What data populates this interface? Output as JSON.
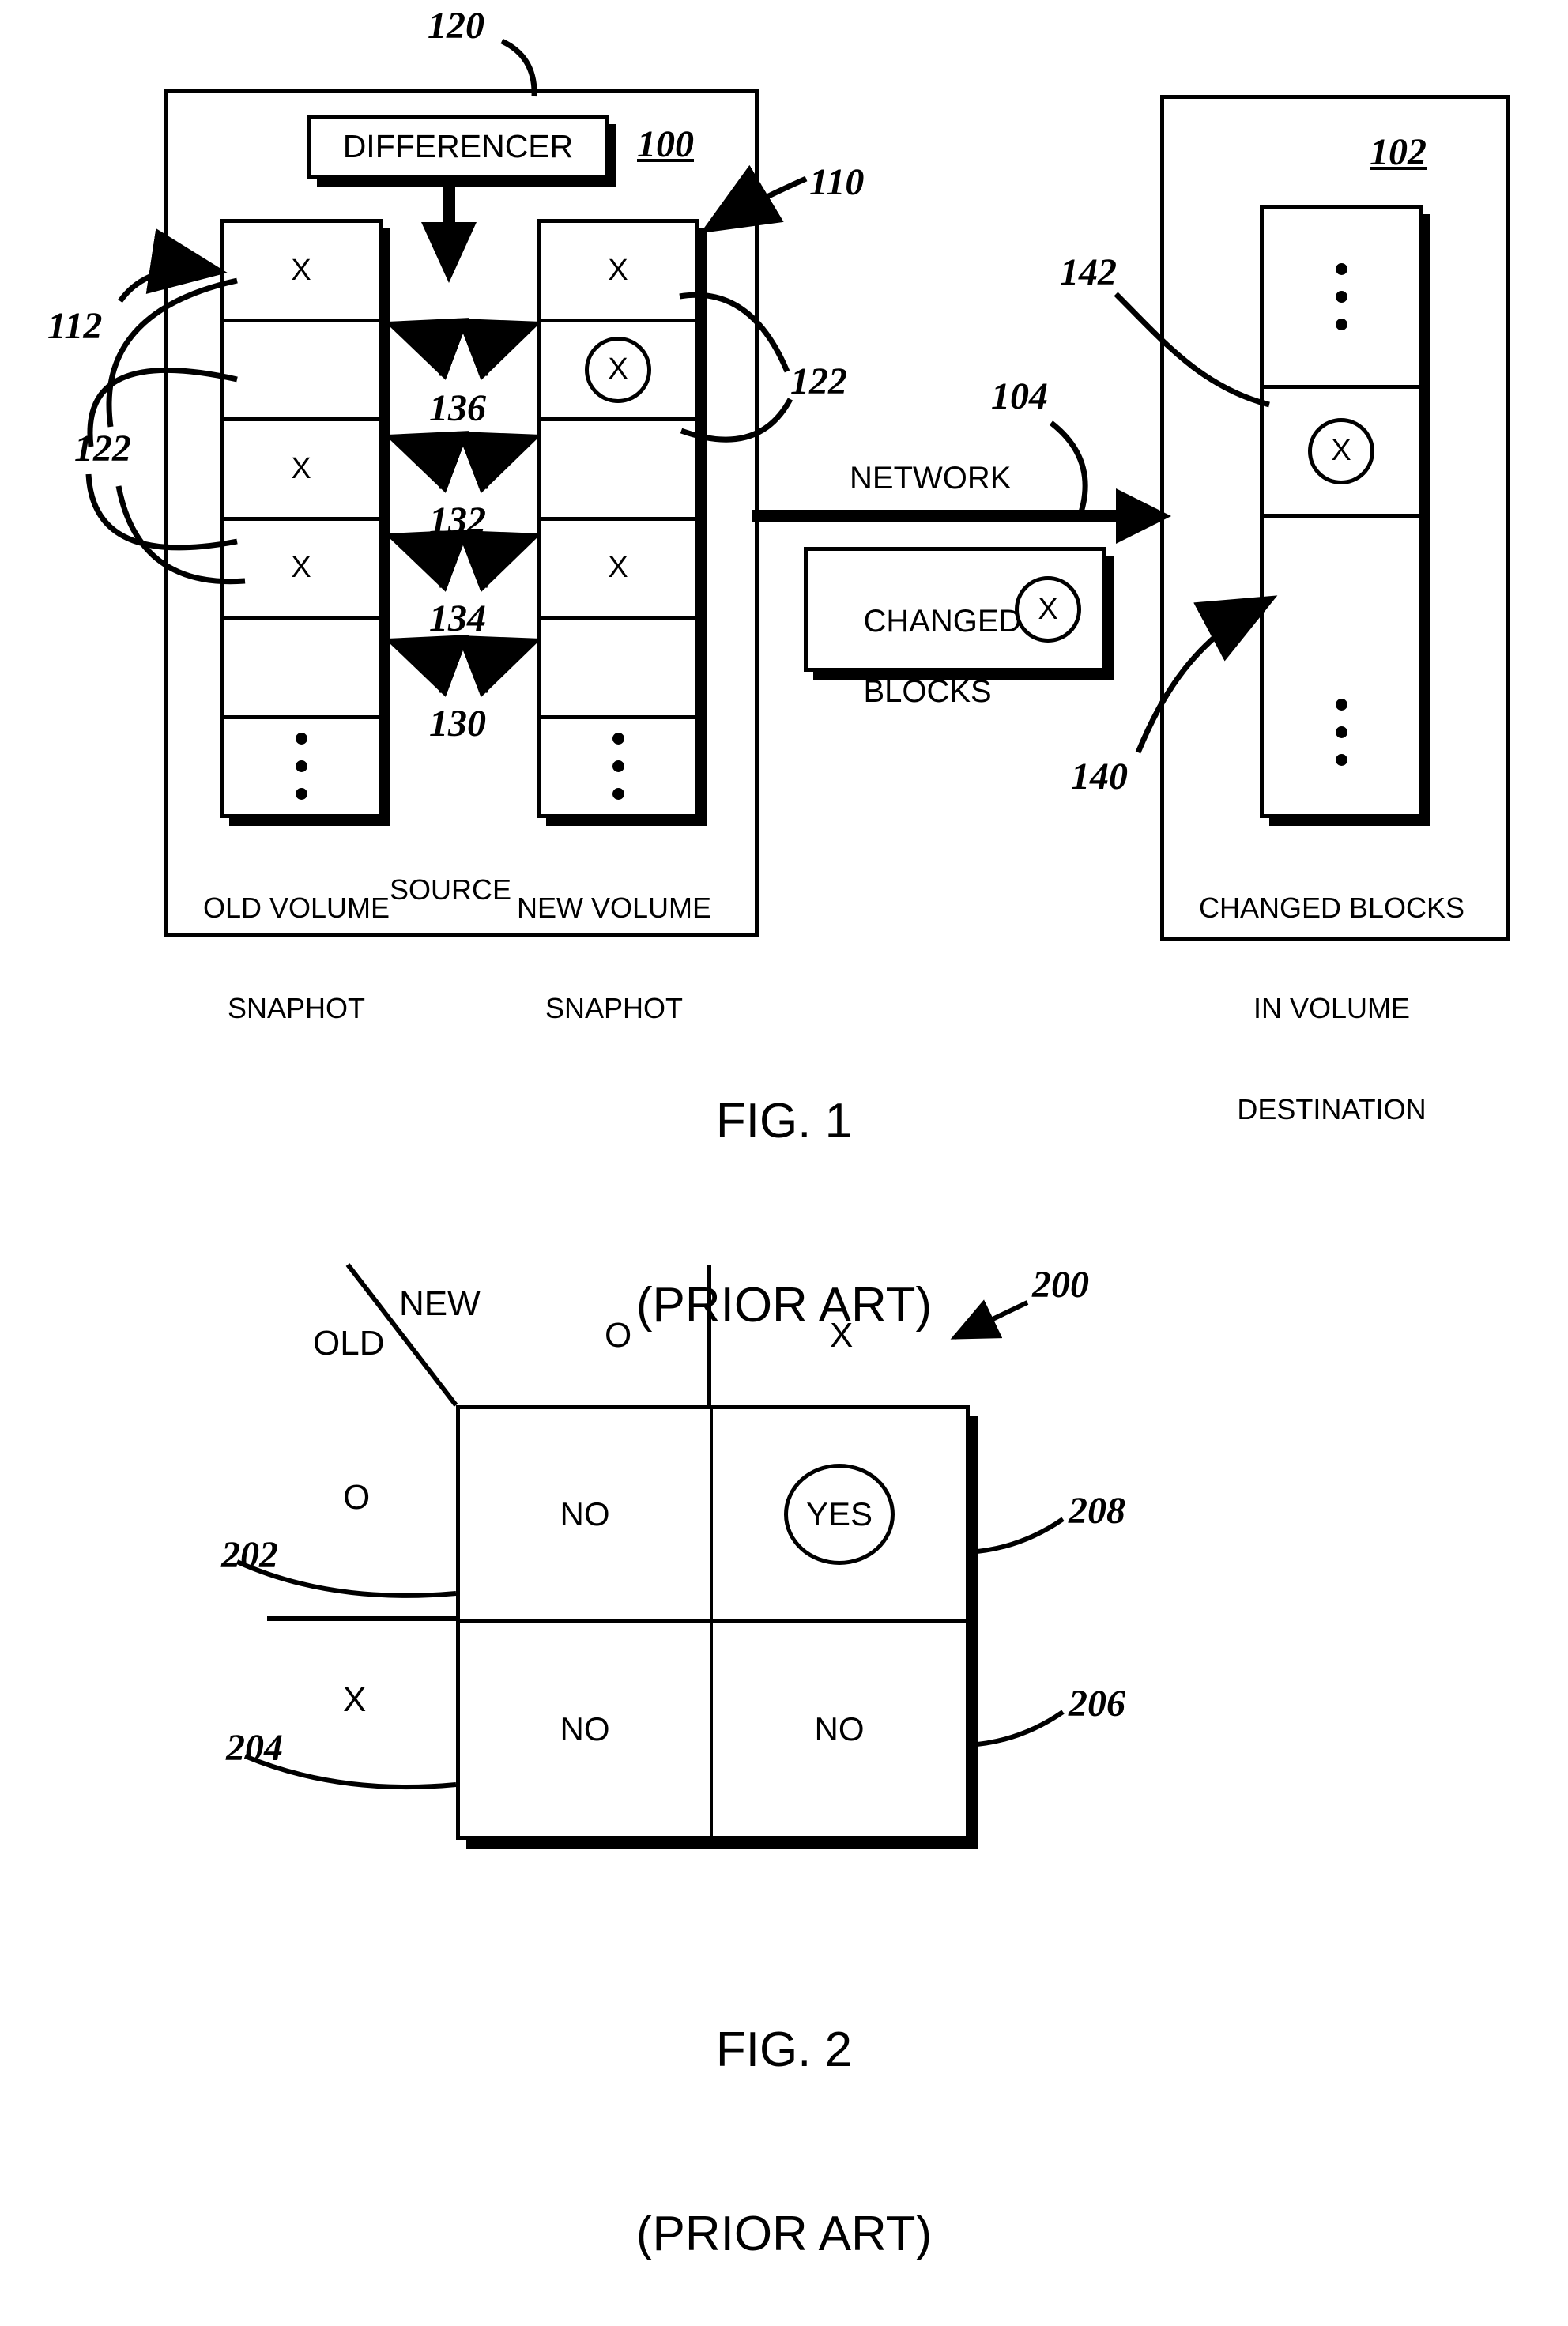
{
  "figure1": {
    "caption_line1": "FIG. 1",
    "caption_line2": "(PRIOR ART)",
    "source_panel": {
      "ref": "100",
      "ref_top": "120",
      "footer_label": "SOURCE",
      "differencer_label": "DIFFERENCER",
      "old_column": {
        "label_line1": "OLD VOLUME",
        "label_line2": "SNAPHOT",
        "cells": [
          "X",
          "",
          "X",
          "X",
          "",
          "⋮"
        ]
      },
      "new_column": {
        "ref": "110",
        "label_line1": "NEW VOLUME",
        "label_line2": "SNAPHOT",
        "cells": [
          "X",
          "(X)",
          "",
          "X",
          "",
          "⋮"
        ],
        "circled_index": 1
      },
      "compare_refs": [
        "136",
        "132",
        "134",
        "130"
      ],
      "block_refs": [
        "112",
        "122",
        "122"
      ]
    },
    "network": {
      "label": "NETWORK",
      "ref": "104",
      "changed_blocks_line1": "CHANGED",
      "changed_blocks_line2": "BLOCKS",
      "changed_blocks_mark": "X"
    },
    "destination_panel": {
      "ref": "102",
      "caption_line1": "CHANGED BLOCKS",
      "caption_line2": "IN VOLUME",
      "caption_line3": "DESTINATION",
      "cells": [
        "⋮",
        "(X)",
        "",
        "⋮"
      ],
      "circled_index": 1,
      "refs": {
        "circled_block": "142",
        "column": "140"
      }
    }
  },
  "figure2": {
    "caption_line1": "FIG. 2",
    "caption_line2": "(PRIOR ART)",
    "ref": "200",
    "axis_label_new": "NEW",
    "axis_label_old": "OLD",
    "col_headers": [
      "O",
      "X"
    ],
    "row_headers": [
      "O",
      "X"
    ],
    "row_header_refs": [
      "202",
      "204"
    ],
    "cell_refs": [
      "208",
      "206"
    ],
    "cells": [
      [
        "NO",
        "YES"
      ],
      [
        "NO",
        "NO"
      ]
    ],
    "circled_cell": {
      "row": 0,
      "col": 1
    }
  },
  "colors": {
    "ink": "#000000",
    "paper": "#ffffff"
  }
}
